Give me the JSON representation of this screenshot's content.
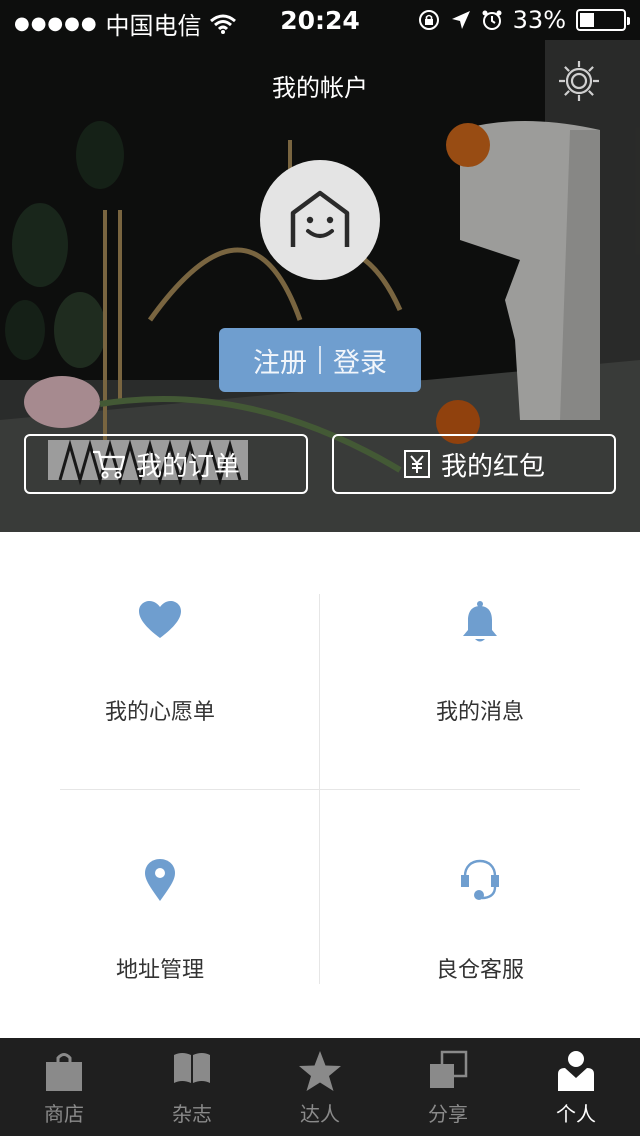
{
  "status_bar": {
    "signal": "●●●●●",
    "carrier": "中国电信",
    "time": "20:24",
    "battery": "33%",
    "battery_level": 0.33
  },
  "header": {
    "title": "我的帐户"
  },
  "auth": {
    "register_label": "注册",
    "login_label": "登录"
  },
  "quick_actions": {
    "orders_label": "我的订单",
    "red_packet_label": "我的红包"
  },
  "grid": [
    {
      "label": "我的心愿单",
      "icon": "heart-icon"
    },
    {
      "label": "我的消息",
      "icon": "bell-icon"
    },
    {
      "label": "地址管理",
      "icon": "location-pin-icon"
    },
    {
      "label": "良仓客服",
      "icon": "headset-icon"
    }
  ],
  "tabs": [
    {
      "label": "商店",
      "icon": "shopping-bag-icon",
      "active": false
    },
    {
      "label": "杂志",
      "icon": "book-icon",
      "active": false
    },
    {
      "label": "达人",
      "icon": "star-icon",
      "active": false
    },
    {
      "label": "分享",
      "icon": "share-squares-icon",
      "active": false
    },
    {
      "label": "个人",
      "icon": "person-icon",
      "active": true
    }
  ],
  "colors": {
    "accent": "#6f9ecf",
    "tabbar_bg": "#1f1f1f",
    "tab_inactive": "#8a8a8a",
    "tab_active": "#ffffff"
  }
}
